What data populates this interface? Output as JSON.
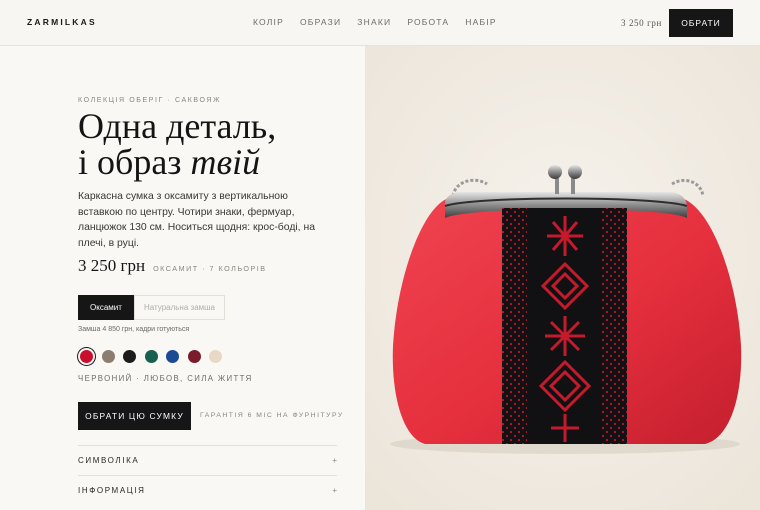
{
  "brand": "ZARMILKAS",
  "nav": [
    "КОЛІР",
    "ОБРАЗИ",
    "ЗНАКИ",
    "РОБОТА",
    "НАБІР"
  ],
  "header": {
    "price": "3 250 грн",
    "cta": "ОБРАТИ"
  },
  "product": {
    "eyebrow": "КОЛЕКЦІЯ ОБЕРІГ · САКВОЯЖ",
    "title_line1": "Одна деталь,",
    "title_line2_prefix": "і образ ",
    "title_line2_em": "твій",
    "description": "Каркасна сумка з оксамиту з вертикальною вставкою по центру. Чотири знаки, фермуар, ланцюжок 130 см. Носиться щодня: крос-боді, на плечі, в руці.",
    "price": "3 250 грн",
    "price_meta": "ОКСАМИТ · 7 КОЛЬОРІВ"
  },
  "materials": [
    {
      "label": "Оксамит",
      "active": true
    },
    {
      "label": "Натуральна замша",
      "active": false
    }
  ],
  "material_note": "Замша 4 850 грн, кадри готуються",
  "colors": [
    {
      "name": "червоний",
      "hex": "#c8102e",
      "selected": true
    },
    {
      "name": "бежево-сірий",
      "hex": "#8b7d70",
      "selected": false
    },
    {
      "name": "чорний",
      "hex": "#1c1c1c",
      "selected": false
    },
    {
      "name": "смарагдовий",
      "hex": "#16604f",
      "selected": false
    },
    {
      "name": "синій",
      "hex": "#1c4a95",
      "selected": false
    },
    {
      "name": "бордовий",
      "hex": "#7a1c2c",
      "selected": false
    },
    {
      "name": "молочний",
      "hex": "#e8d9c6",
      "selected": false
    }
  ],
  "color_caption": "ЧЕРВОНИЙ · ЛЮБОВ, СИЛА ЖИТТЯ",
  "buy_button": "ОБРАТИ ЦЮ СУМКУ",
  "guarantee": "ГАРАНТІЯ 6 МІС НА ФУРНІТУРУ",
  "accordion": [
    {
      "label": "СИМВОЛІКА",
      "icon": "+"
    },
    {
      "label": "ІНФОРМАЦІЯ",
      "icon": "+"
    }
  ],
  "icons": {
    "expand": "plus-icon"
  },
  "theme": {
    "accent": "#161616",
    "bag_red": "#e8323f",
    "embroidery": "#c01a2a"
  }
}
